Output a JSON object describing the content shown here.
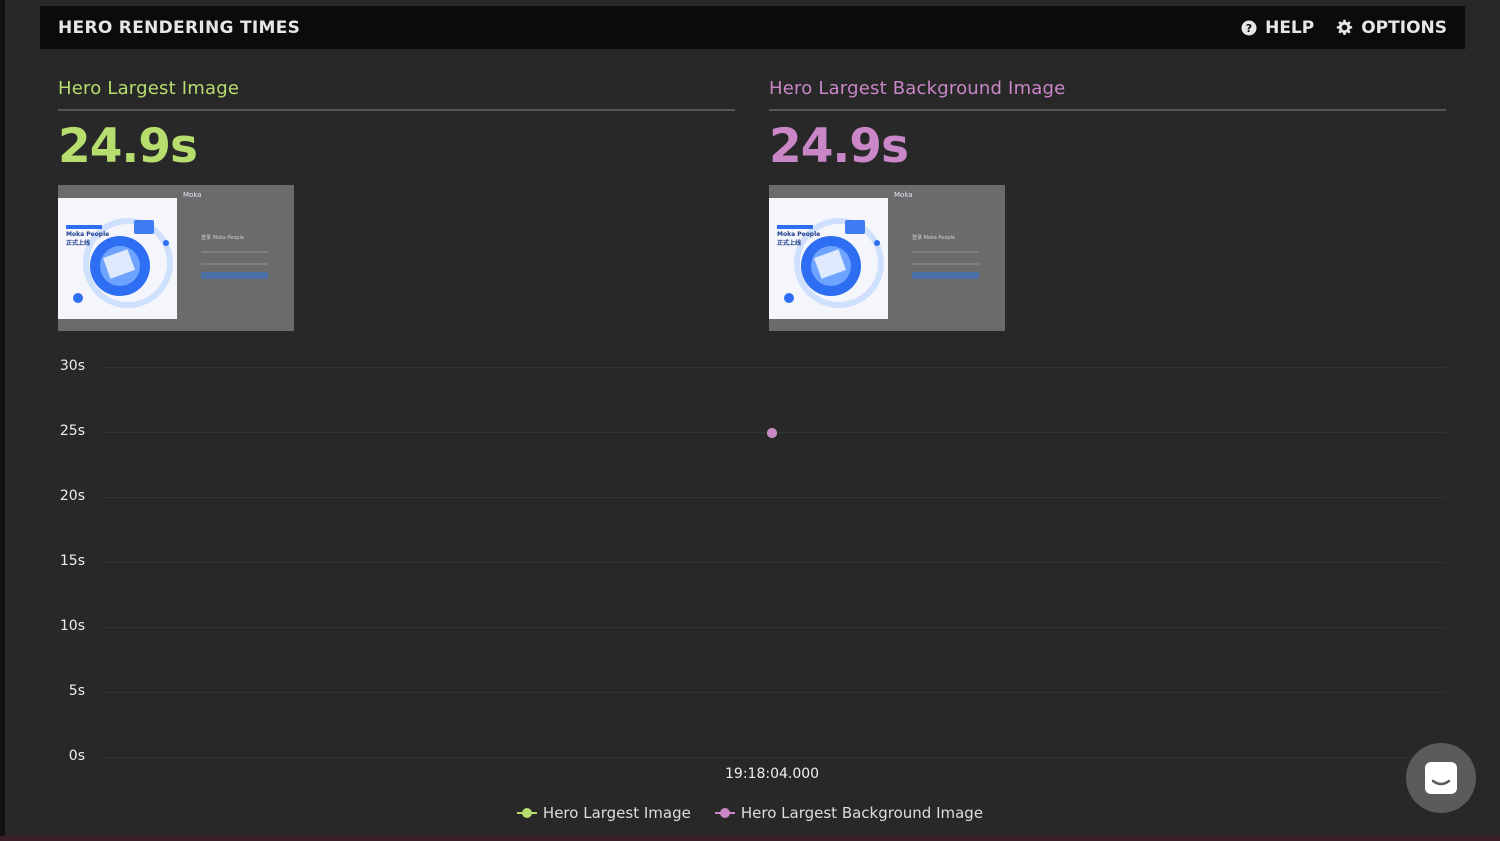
{
  "header": {
    "title": "HERO RENDERING TIMES",
    "help_label": "HELP",
    "options_label": "OPTIONS"
  },
  "metrics": [
    {
      "label": "Hero Largest Image",
      "value": "24.9s",
      "color": "#b7dd6f"
    },
    {
      "label": "Hero Largest Background Image",
      "value": "24.9s",
      "color": "#c987c8"
    }
  ],
  "thumbnail": {
    "brand": "Moka",
    "headline": "Moka People",
    "subline": "正式上线",
    "login_title": "登录 Moka People"
  },
  "chart_data": {
    "type": "scatter",
    "y_ticks": [
      "30s",
      "25s",
      "20s",
      "15s",
      "10s",
      "5s",
      "0s"
    ],
    "ylim": [
      0,
      30
    ],
    "x_ticks": [
      "19:18:04.000"
    ],
    "series": [
      {
        "name": "Hero Largest Image",
        "color": "#b7dd6f",
        "points": [
          {
            "x": "19:18:04.000",
            "y": 24.9
          }
        ]
      },
      {
        "name": "Hero Largest Background Image",
        "color": "#c987c8",
        "points": [
          {
            "x": "19:18:04.000",
            "y": 24.9
          }
        ]
      }
    ],
    "legend_position": "bottom"
  },
  "colors": {
    "header_bg": "#0b0b0b",
    "panel_bg": "#282828",
    "accent_green": "#b7dd6f",
    "accent_purple": "#c987c8"
  },
  "icons": {
    "help": "question-circle-icon",
    "options": "gear-icon",
    "chat": "chat-bubble-icon"
  }
}
